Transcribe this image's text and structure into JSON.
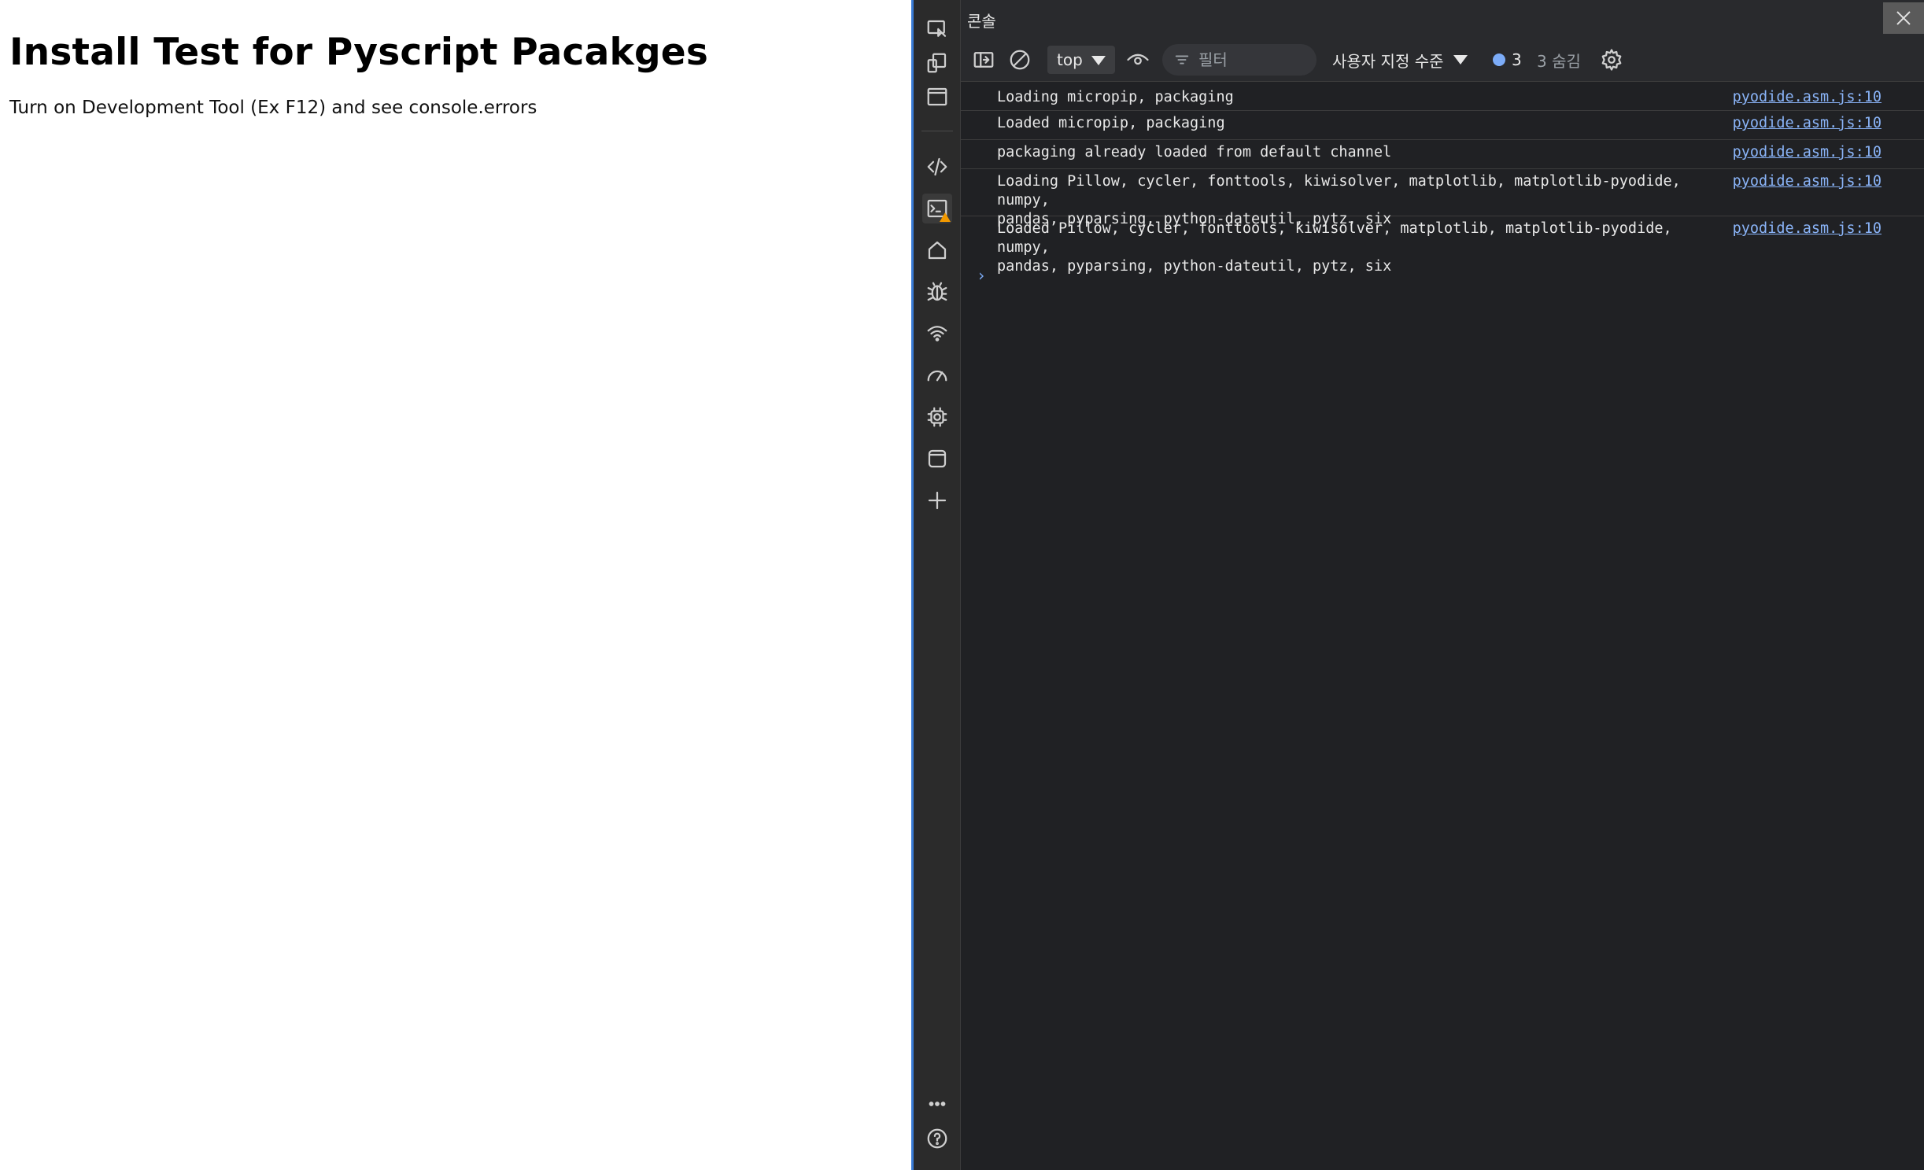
{
  "page": {
    "heading": "Install Test for Pyscript Pacakges",
    "description": "Turn on Development Tool (Ex F12) and see console.errors"
  },
  "devtools": {
    "panel_title": "콘솔",
    "activity_icons": [
      "inspect-icon",
      "device-emulation-icon",
      "dock-icon",
      "elements-icon",
      "console-icon",
      "welcome-home-icon",
      "sources-bug-icon",
      "network-wifi-icon",
      "performance-icon",
      "memory-chip-icon",
      "application-icon",
      "add-tool-icon",
      "more-tools-icon",
      "help-icon"
    ],
    "toolbar": {
      "context_value": "top",
      "filter_placeholder": "필터",
      "level_label": "사용자 지정 수준",
      "message_count": "3",
      "hidden_label": "3 숨김"
    },
    "messages": [
      {
        "text": "Loading micropip, packaging",
        "source": "pyodide.asm.js:10"
      },
      {
        "text": "Loaded micropip, packaging",
        "source": "pyodide.asm.js:10"
      },
      {
        "text": "packaging already loaded from default channel",
        "source": "pyodide.asm.js:10"
      },
      {
        "text": "Loading Pillow, cycler, fonttools, kiwisolver, matplotlib, matplotlib-pyodide, numpy,\npandas, pyparsing, python-dateutil, pytz, six",
        "source": "pyodide.asm.js:10"
      },
      {
        "text": "Loaded Pillow, cycler, fonttools, kiwisolver, matplotlib, matplotlib-pyodide, numpy,\npandas, pyparsing, python-dateutil, pytz, six",
        "source": "pyodide.asm.js:10"
      }
    ],
    "prompt_symbol": "›",
    "colors": {
      "accent": "#3a7bd5",
      "link": "#8ab4f8",
      "background": "#202124"
    }
  }
}
